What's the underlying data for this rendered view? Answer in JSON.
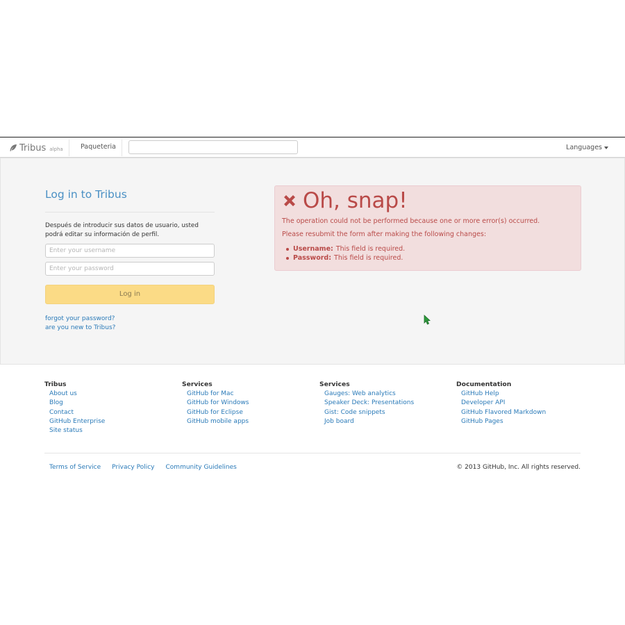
{
  "navbar": {
    "brand_name": "Tribus",
    "brand_tag": "alpha",
    "nav_link": "Paqueteria",
    "search_value": "",
    "languages_label": "Languages"
  },
  "login": {
    "title": "Log in to Tribus",
    "description": "Después de introducir sus datos de usuario, usted podrá editar su información de perfil.",
    "username_placeholder": "Enter your username",
    "password_placeholder": "Enter your password",
    "button_label": "Log in",
    "forgot_link": "forgot your password?",
    "new_link": "are you new to Tribus?"
  },
  "alert": {
    "title": "Oh, snap!",
    "message1": "The operation could not be performed because one or more error(s) occurred.",
    "message2": "Please resubmit the form after making the following changes:",
    "errors": [
      {
        "field": "Username:",
        "text": "This field is required."
      },
      {
        "field": "Password:",
        "text": "This field is required."
      }
    ],
    "color": "#b94a48"
  },
  "footer": {
    "columns": [
      {
        "heading": "Tribus",
        "links": [
          "About us",
          "Blog",
          "Contact",
          "GitHub Enterprise",
          "Site status"
        ]
      },
      {
        "heading": "Services",
        "links": [
          "GitHub for Mac",
          "GitHub for Windows",
          "GitHub for Eclipse",
          "GitHub mobile apps"
        ]
      },
      {
        "heading": "Services",
        "links": [
          "Gauges: Web analytics",
          "Speaker Deck: Presentations",
          "Gist: Code snippets",
          "Job board"
        ]
      },
      {
        "heading": "Documentation",
        "links": [
          "GitHub Help",
          "Developer API",
          "GitHub Flavored Markdown",
          "GitHub Pages"
        ]
      }
    ],
    "bottom_links": [
      "Terms of Service",
      "Privacy Policy",
      "Community Guidelines"
    ],
    "copyright": "© 2013 GitHub, Inc. All rights reserved."
  },
  "colors": {
    "link": "#2a7ab8",
    "login_title": "#4a90c4",
    "login_button": "#fbdb86",
    "alert_bg": "#f2dede"
  },
  "icons": [
    "feather-icon",
    "close-x-icon",
    "caret-down-icon",
    "mouse-cursor-icon"
  ]
}
